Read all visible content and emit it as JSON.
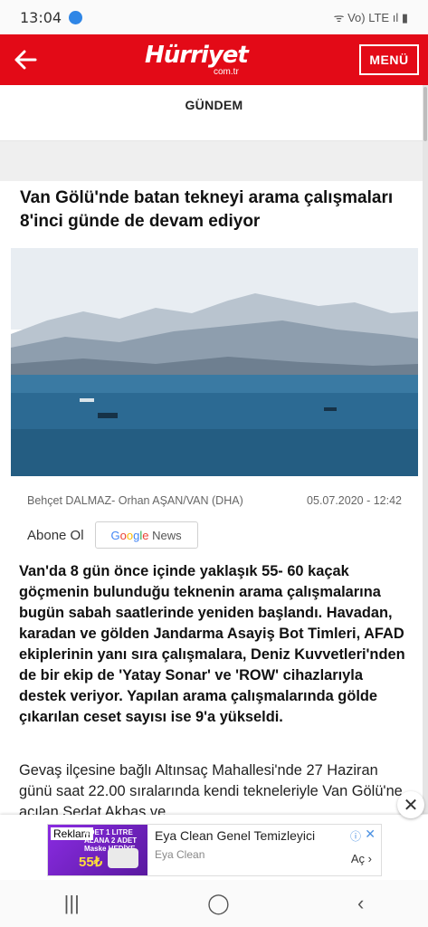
{
  "status": {
    "time": "13:04",
    "right": "ᯤ Vo) LTE ıl ▮"
  },
  "header": {
    "logo": "Hürriyet",
    "logo_sub": "com.tr",
    "menu_label": "MENÜ"
  },
  "section": {
    "label": "GÜNDEM"
  },
  "article": {
    "title": "Van Gölü'nde batan tekneyi arama çalışmaları 8'inci günde de devam ediyor",
    "author": "Behçet DALMAZ- Orhan AŞAN/VAN (DHA)",
    "date": "05.07.2020 - 12:42",
    "follow_label": "Abone Ol",
    "gnews_a": "G",
    "gnews_b": "o",
    "gnews_c": "o",
    "gnews_d": "g",
    "gnews_e": "l",
    "gnews_f": "e",
    "gnews_suffix": "News",
    "lead": "Van'da 8 gün önce içinde yaklaşık 55- 60 kaçak göçmenin bulunduğu teknenin arama çalışmalarına bugün sabah saatlerinde yeniden başlandı. Havadan, karadan ve gölden Jandarma Asayiş Bot Timleri, AFAD ekiplerinin yanı sıra çalışmalara, Deniz Kuvvetleri'nden de bir ekip de 'Yatay Sonar' ve 'ROW' cihazlarıyla destek veriyor. Yapılan arama çalışmalarında gölde çıkarılan ceset sayısı ise 9'a yükseldi.",
    "body": "Gevaş ilçesine bağlı Altınsaç Mahallesi'nde 27 Haziran günü saat 22.00 sıralarında kendi tekneleriyle Van Gölü'ne açılan Sedat Akbaş ve"
  },
  "ad": {
    "tag": "Reklam",
    "thumb_text": "ADET 1 LITRE ALANA 2 ADET Maske HEDİYE",
    "price": "55₺",
    "title": "Eya Clean Genel Temizleyici",
    "sub": "Eya Clean",
    "go": "Aç ›",
    "close": "✕"
  },
  "colors": {
    "brand": "#e30a17",
    "sea": "#2c6a93"
  }
}
